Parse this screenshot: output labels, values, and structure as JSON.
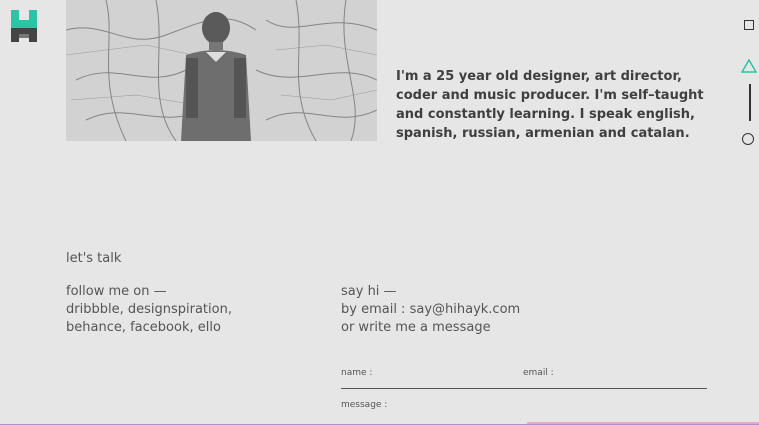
{
  "brand": {
    "logo_icon": "h-logo-icon",
    "accent": "#2bc4a4"
  },
  "bio": {
    "text": "I'm a 25 year old designer, art director, coder and music producer. I'm self–taught and constantly learning. I speak english, spanish, russian, armenian and catalan."
  },
  "nav": {
    "items": [
      "square-icon",
      "triangle-icon",
      "circle-icon"
    ],
    "active": "triangle-icon"
  },
  "contact": {
    "heading": "let's talk",
    "follow": [
      "follow me on —",
      "dribbble, designspiration,",
      "behance, facebook, ello"
    ],
    "sayhi": [
      "say hi —",
      "by email : say@hihayk.com",
      "or write me a message"
    ]
  },
  "form": {
    "name_label": "name :",
    "email_label": "email :",
    "message_label": "message :"
  }
}
